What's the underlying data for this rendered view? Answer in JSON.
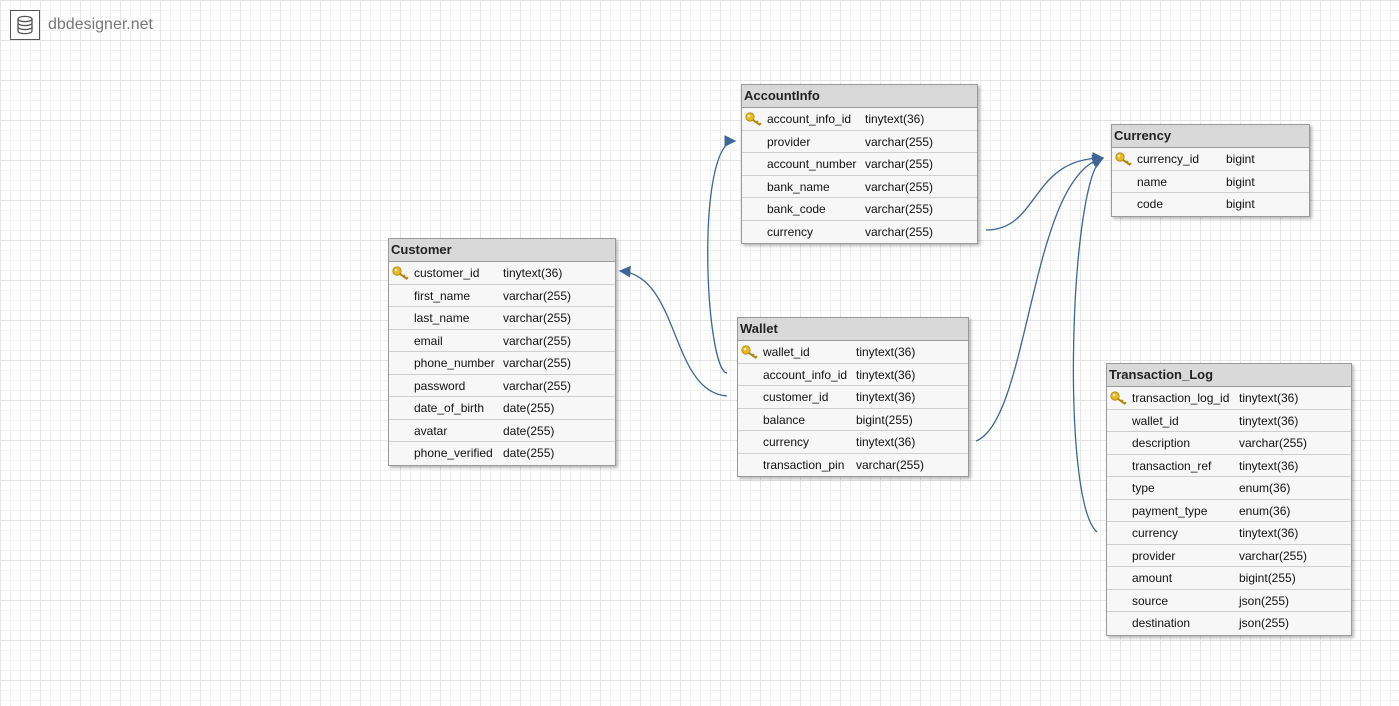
{
  "app": {
    "logo_text": "dbdesigner.net"
  },
  "tables": {
    "accountinfo": {
      "title": "AccountInfo",
      "columns": [
        {
          "name": "account_info_id",
          "type": "tinytext(36)",
          "pk": true
        },
        {
          "name": "provider",
          "type": "varchar(255)"
        },
        {
          "name": "account_number",
          "type": "varchar(255)"
        },
        {
          "name": "bank_name",
          "type": "varchar(255)"
        },
        {
          "name": "bank_code",
          "type": "varchar(255)"
        },
        {
          "name": "currency",
          "type": "varchar(255)"
        }
      ]
    },
    "currency": {
      "title": "Currency",
      "columns": [
        {
          "name": "currency_id",
          "type": "bigint",
          "pk": true
        },
        {
          "name": "name",
          "type": "bigint"
        },
        {
          "name": "code",
          "type": "bigint"
        }
      ]
    },
    "customer": {
      "title": "Customer",
      "columns": [
        {
          "name": "customer_id",
          "type": "tinytext(36)",
          "pk": true
        },
        {
          "name": "first_name",
          "type": "varchar(255)"
        },
        {
          "name": "last_name",
          "type": "varchar(255)"
        },
        {
          "name": "email",
          "type": "varchar(255)"
        },
        {
          "name": "phone_number",
          "type": "varchar(255)"
        },
        {
          "name": "password",
          "type": "varchar(255)"
        },
        {
          "name": "date_of_birth",
          "type": "date(255)"
        },
        {
          "name": "avatar",
          "type": "date(255)"
        },
        {
          "name": "phone_verified",
          "type": "date(255)"
        }
      ]
    },
    "wallet": {
      "title": "Wallet",
      "columns": [
        {
          "name": "wallet_id",
          "type": "tinytext(36)",
          "pk": true
        },
        {
          "name": "account_info_id",
          "type": "tinytext(36)"
        },
        {
          "name": "customer_id",
          "type": "tinytext(36)"
        },
        {
          "name": "balance",
          "type": "bigint(255)"
        },
        {
          "name": "currency",
          "type": "tinytext(36)"
        },
        {
          "name": "transaction_pin",
          "type": "varchar(255)"
        }
      ]
    },
    "transaction_log": {
      "title": "Transaction_Log",
      "columns": [
        {
          "name": "transaction_log_id",
          "type": "tinytext(36)",
          "pk": true
        },
        {
          "name": "wallet_id",
          "type": "tinytext(36)"
        },
        {
          "name": "description",
          "type": "varchar(255)"
        },
        {
          "name": "transaction_ref",
          "type": "tinytext(36)"
        },
        {
          "name": "type",
          "type": "enum(36)"
        },
        {
          "name": "payment_type",
          "type": "enum(36)"
        },
        {
          "name": "currency",
          "type": "tinytext(36)"
        },
        {
          "name": "provider",
          "type": "varchar(255)"
        },
        {
          "name": "amount",
          "type": "bigint(255)"
        },
        {
          "name": "source",
          "type": "json(255)"
        },
        {
          "name": "destination",
          "type": "json(255)"
        }
      ]
    }
  },
  "relations": [
    {
      "from": "accountinfo.currency",
      "to": "currency.currency_id"
    },
    {
      "from": "wallet.currency",
      "to": "currency.currency_id"
    },
    {
      "from": "transaction_log.currency",
      "to": "currency.currency_id"
    },
    {
      "from": "wallet.account_info_id",
      "to": "accountinfo.account_info_id"
    },
    {
      "from": "wallet.customer_id",
      "to": "customer.customer_id"
    }
  ],
  "colors": {
    "relation_line": "#3d6597",
    "key_icon": "#e8b820",
    "table_header": "#d9d9d9",
    "table_body": "#f7f7f7"
  }
}
